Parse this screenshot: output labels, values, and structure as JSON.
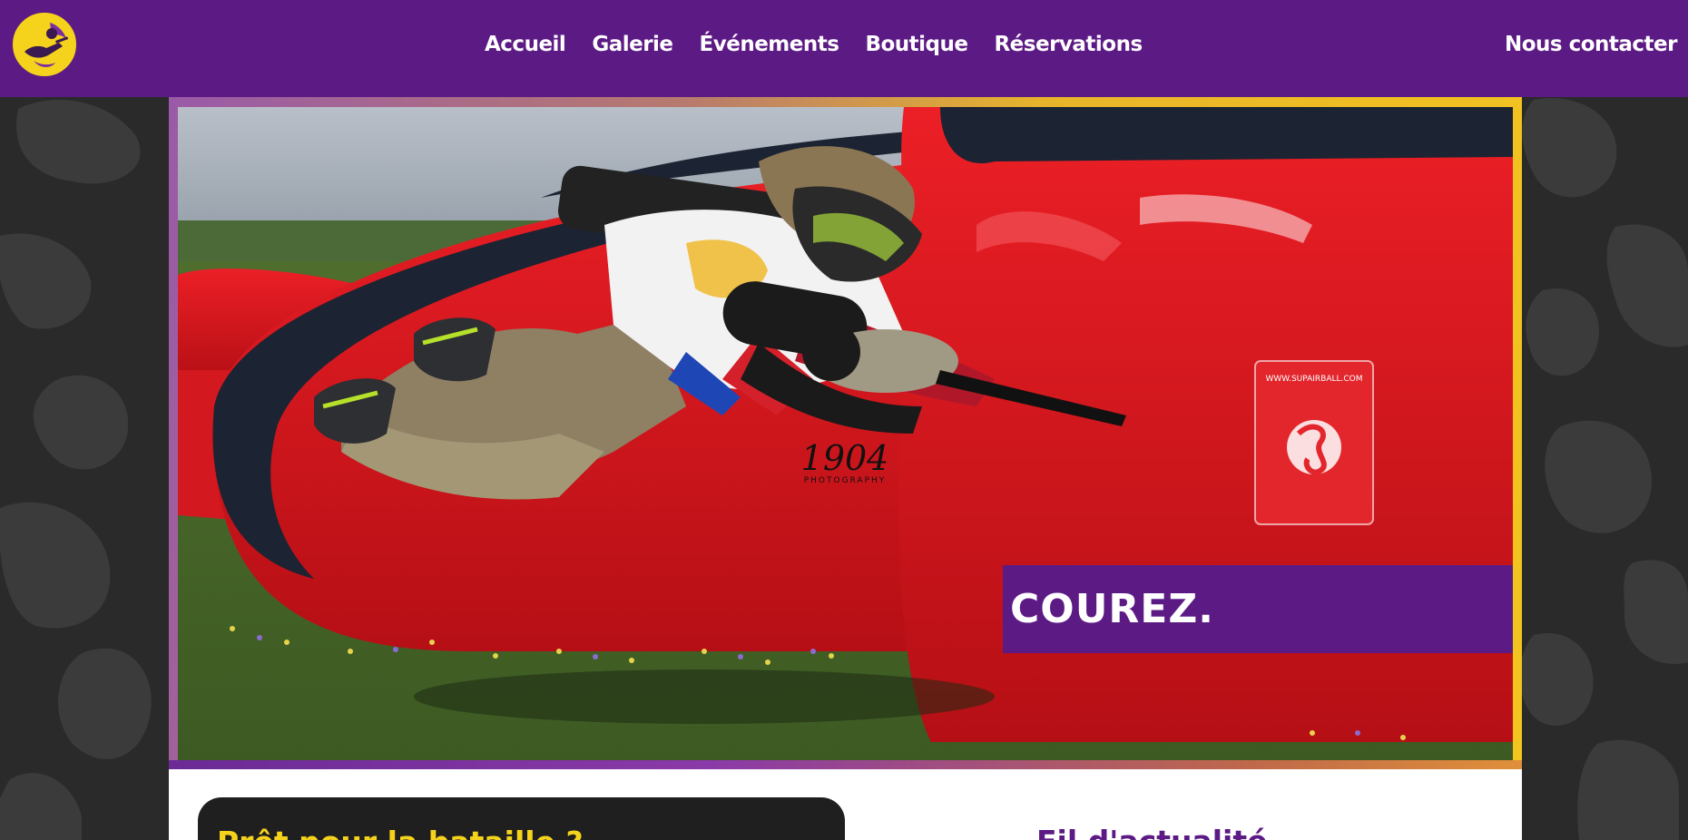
{
  "nav": {
    "logo_alt": "paintball-logo",
    "links": [
      {
        "label": "Accueil"
      },
      {
        "label": "Galerie"
      },
      {
        "label": "Événements"
      },
      {
        "label": "Boutique"
      },
      {
        "label": "Réservations"
      }
    ],
    "contact_label": "Nous contacter"
  },
  "hero": {
    "caption": "COUREZ.",
    "watermark_line1": "1904",
    "watermark_line2": "PHOTOGRAPHY",
    "bunker_text": "WWW.SUPAIRBALL.COM"
  },
  "sections": {
    "battle_title": "Prêt pour la bataille ?",
    "news_title": "Fil d'actualité"
  },
  "colors": {
    "brand_purple": "#5c1a85",
    "accent_yellow": "#f5d21c",
    "dark_bg": "#262626",
    "card_dark": "#1f1f1f"
  }
}
